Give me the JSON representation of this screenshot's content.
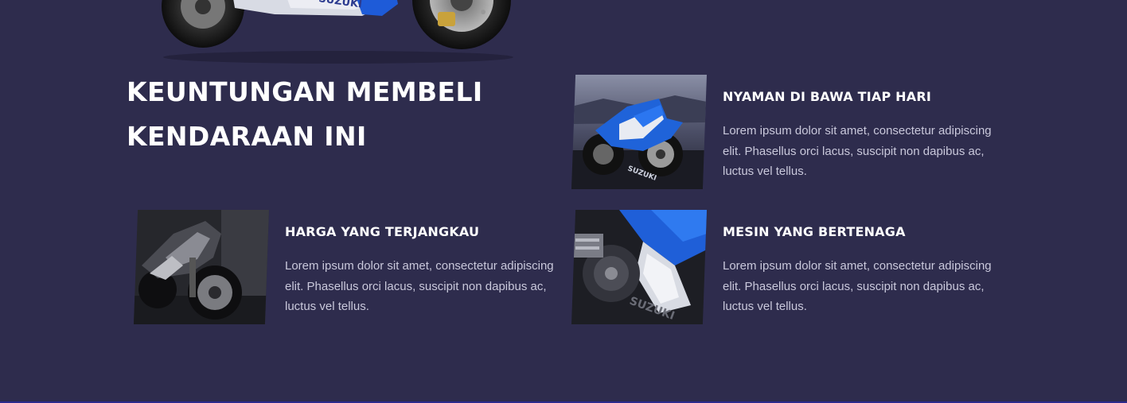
{
  "section": {
    "title_line1": "KEUNTUNGAN MEMBELI",
    "title_line2": "KENDARAAN INI"
  },
  "hero": {
    "brand_text": "SUZUKI",
    "icon": "motorcycle-image"
  },
  "features": [
    {
      "title": "NYAMAN DI BAWA TIAP HARI",
      "description": "Lorem ipsum dolor sit amet, consectetur adipiscing elit. Phasellus orci lacus, suscipit non dapibus ac, luctus vel tellus.",
      "image": "blue-suzuki-sportbike-photo"
    },
    {
      "title": "HARGA YANG TERJANGKAU",
      "description": "Lorem ipsum dolor sit amet, consectetur adipiscing elit. Phasellus orci lacus, suscipit non dapibus ac, luctus vel tellus.",
      "image": "black-sportbike-photo"
    },
    {
      "title": "MESIN YANG BERTENAGA",
      "description": "Lorem ipsum dolor sit amet, consectetur adipiscing elit. Phasellus orci lacus, suscipit non dapibus ac, luctus vel tellus.",
      "image": "suzuki-engine-closeup-photo"
    }
  ],
  "colors": {
    "background": "#2e2c4d",
    "heading": "#ffffff",
    "body_text": "#c9c8db",
    "accent_blue": "#2f6fd6"
  }
}
